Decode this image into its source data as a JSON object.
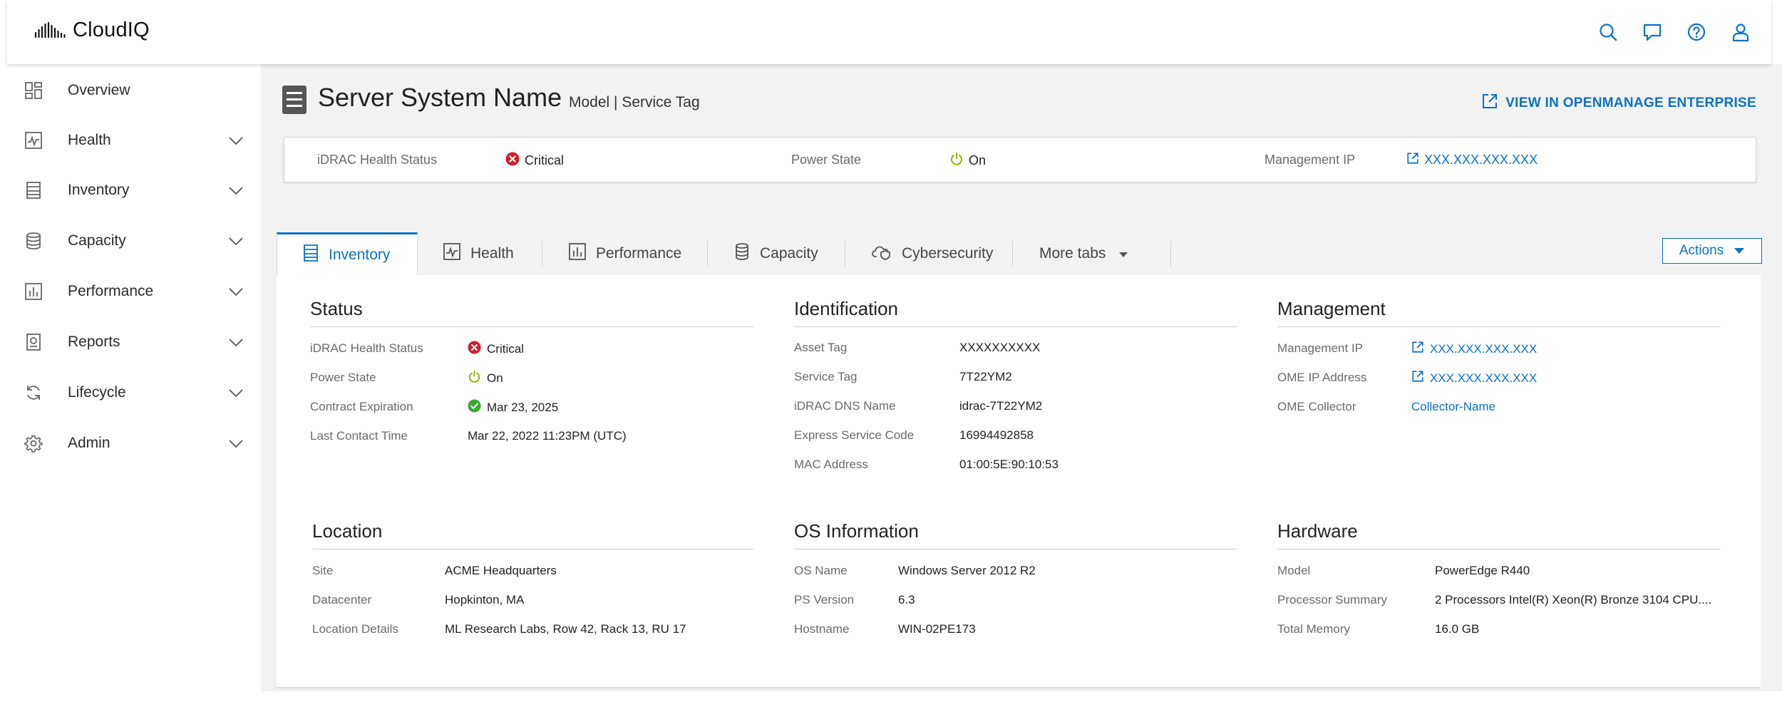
{
  "app": {
    "name": "CloudIQ"
  },
  "topbar": {
    "icons": [
      "search-icon",
      "chat-icon",
      "help-icon",
      "user-icon"
    ]
  },
  "sidebar": {
    "items": [
      {
        "label": "Overview",
        "icon": "grid-icon",
        "expandable": false
      },
      {
        "label": "Health",
        "icon": "health-icon",
        "expandable": true
      },
      {
        "label": "Inventory",
        "icon": "inventory-icon",
        "expandable": true
      },
      {
        "label": "Capacity",
        "icon": "database-icon",
        "expandable": true
      },
      {
        "label": "Performance",
        "icon": "bar-chart-icon",
        "expandable": true
      },
      {
        "label": "Reports",
        "icon": "report-icon",
        "expandable": true
      },
      {
        "label": "Lifecycle",
        "icon": "refresh-icon",
        "expandable": true
      },
      {
        "label": "Admin",
        "icon": "gear-icon",
        "expandable": true
      }
    ]
  },
  "header": {
    "title": "Server System Name",
    "subtitle": "Model | Service Tag",
    "view_link": "VIEW IN OPENMANAGE ENTERPRISE"
  },
  "summary": {
    "health_label": "iDRAC Health Status",
    "health_value": "Critical",
    "power_label": "Power State",
    "power_value": "On",
    "mgmt_label": "Management IP",
    "mgmt_value": "XXX.XXX.XXX.XXX"
  },
  "tabs": {
    "items": [
      "Inventory",
      "Health",
      "Performance",
      "Capacity",
      "Cybersecurity",
      "More tabs"
    ],
    "active": "Inventory",
    "actions_label": "Actions"
  },
  "sections": {
    "status": {
      "title": "Status",
      "rows": [
        {
          "label": "iDRAC Health Status",
          "value": "Critical"
        },
        {
          "label": "Power State",
          "value": "On"
        },
        {
          "label": "Contract Expiration",
          "value": "Mar 23, 2025"
        },
        {
          "label": "Last Contact Time",
          "value": "Mar 22, 2022 11:23PM (UTC)"
        }
      ]
    },
    "identification": {
      "title": "Identification",
      "rows": [
        {
          "label": "Asset Tag",
          "value": "XXXXXXXXXX"
        },
        {
          "label": "Service Tag",
          "value": "7T22YM2"
        },
        {
          "label": "iDRAC DNS Name",
          "value": "idrac-7T22YM2"
        },
        {
          "label": "Express Service Code",
          "value": "16994492858"
        },
        {
          "label": "MAC Address",
          "value": "01:00:5E:90:10:53"
        }
      ]
    },
    "management": {
      "title": "Management",
      "rows": [
        {
          "label": "Management IP",
          "value": "XXX.XXX.XXX.XXX"
        },
        {
          "label": "OME IP Address",
          "value": "XXX.XXX.XXX.XXX"
        },
        {
          "label": "OME Collector",
          "value": "Collector-Name"
        }
      ]
    },
    "location": {
      "title": "Location",
      "rows": [
        {
          "label": "Site",
          "value": "ACME Headquarters"
        },
        {
          "label": "Datacenter",
          "value": "Hopkinton, MA"
        },
        {
          "label": "Location Details",
          "value": "ML Research Labs, Row 42, Rack 13, RU 17"
        }
      ]
    },
    "os": {
      "title": "OS Information",
      "rows": [
        {
          "label": "OS Name",
          "value": "Windows Server 2012 R2"
        },
        {
          "label": "PS Version",
          "value": "6.3"
        },
        {
          "label": "Hostname",
          "value": "WIN-02PE173"
        }
      ]
    },
    "hardware": {
      "title": "Hardware",
      "rows": [
        {
          "label": "Model",
          "value": "PowerEdge R440"
        },
        {
          "label": "Processor Summary",
          "value": "2 Processors Intel(R) Xeon(R) Bronze 3104 CPU...."
        },
        {
          "label": "Total Memory",
          "value": "16.0 GB"
        }
      ]
    }
  },
  "colors": {
    "accent": "#0b72c6",
    "critical": "#d0202e",
    "ok": "#3aa832",
    "power": "#8fb400"
  }
}
